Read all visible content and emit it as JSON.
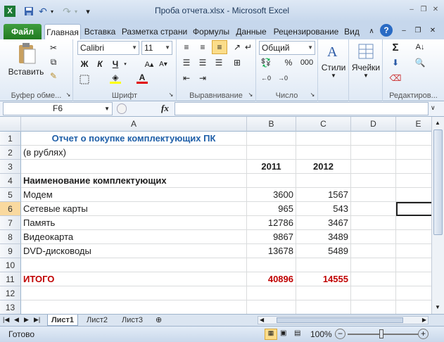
{
  "window": {
    "title": "Проба отчета.xlsx - Microsoft Excel"
  },
  "qat": {
    "excel_icon": "X",
    "save_icon": "save-icon",
    "undo_icon": "↶",
    "redo_icon": "↷",
    "customize": "▾"
  },
  "window_controls": {
    "minimize": "–",
    "restore": "❐",
    "close": "✕",
    "ribbon_min": "–",
    "ribbon_restore": "❐",
    "ribbon_close": "✕"
  },
  "tabs": {
    "file": "Файл",
    "home": "Главная",
    "insert": "Вставка",
    "page_layout": "Разметка страни",
    "formulas": "Формулы",
    "data": "Данные",
    "review": "Рецензирование",
    "view": "Вид"
  },
  "ribbon": {
    "clipboard": {
      "paste": "Вставить",
      "label": "Буфер обме..."
    },
    "font": {
      "name": "Calibri",
      "size": "11",
      "bold": "Ж",
      "italic": "К",
      "underline": "Ч",
      "font_color": "A",
      "label": "Шрифт"
    },
    "alignment": {
      "label": "Выравнивание"
    },
    "number": {
      "format": "Общий",
      "percent": "%",
      "thousands": "000",
      "label": "Число"
    },
    "styles": {
      "label": "Стили"
    },
    "cells": {
      "label": "Ячейки"
    },
    "editing": {
      "sum": "Σ",
      "label": "Редактиров..."
    }
  },
  "formula_bar": {
    "name_box": "F6",
    "fx": "fx",
    "formula": ""
  },
  "columns": [
    "A",
    "B",
    "C",
    "D",
    "E"
  ],
  "rows": [
    {
      "num": "1",
      "a": "Отчет о покупке комплектующих ПК",
      "b": "",
      "c": ""
    },
    {
      "num": "2",
      "a": "(в рублях)",
      "b": "",
      "c": ""
    },
    {
      "num": "3",
      "a": "",
      "b": "2011",
      "c": "2012"
    },
    {
      "num": "4",
      "a": "Наименование комплектующих",
      "b": "",
      "c": ""
    },
    {
      "num": "5",
      "a": "Модем",
      "b": "3600",
      "c": "1567"
    },
    {
      "num": "6",
      "a": "Сетевые карты",
      "b": "965",
      "c": "543"
    },
    {
      "num": "7",
      "a": "Память",
      "b": "12786",
      "c": "3467"
    },
    {
      "num": "8",
      "a": "Видеокарта",
      "b": "9867",
      "c": "3489"
    },
    {
      "num": "9",
      "a": "DVD-дисководы",
      "b": "13678",
      "c": "5489"
    },
    {
      "num": "10",
      "a": "",
      "b": "",
      "c": ""
    },
    {
      "num": "11",
      "a": "ИТОГО",
      "b": "40896",
      "c": "14555"
    },
    {
      "num": "12",
      "a": "",
      "b": "",
      "c": ""
    },
    {
      "num": "13",
      "a": "",
      "b": "",
      "c": ""
    }
  ],
  "sheets": [
    "Лист1",
    "Лист2",
    "Лист3"
  ],
  "status": {
    "ready": "Готово",
    "zoom": "100%",
    "zoom_minus": "−",
    "zoom_plus": "+"
  },
  "colors": {
    "title_blue": "#1f5fa8",
    "total_red": "#c00000",
    "active_row": "#f9d99f"
  }
}
